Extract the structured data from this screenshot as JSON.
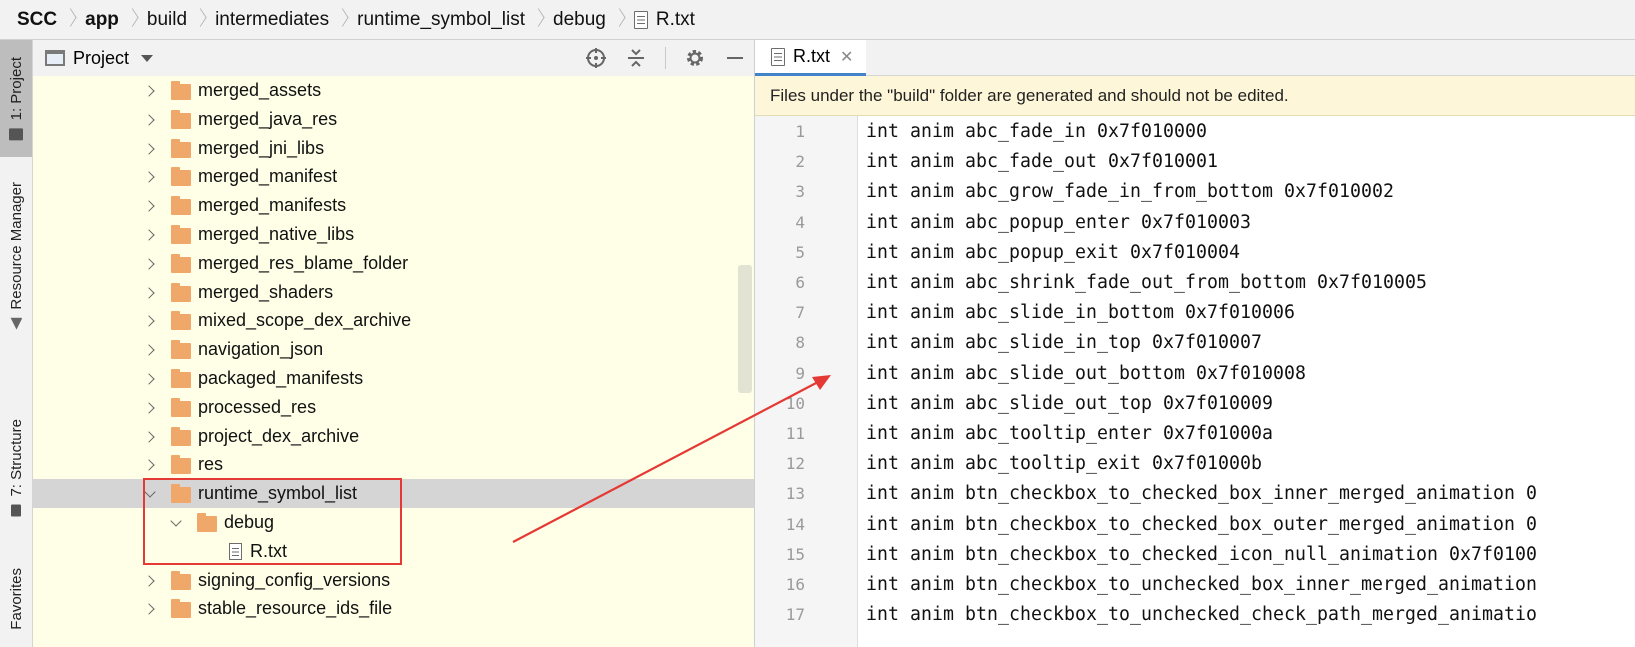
{
  "breadcrumb": {
    "items": [
      "SCC",
      "app",
      "build",
      "intermediates",
      "runtime_symbol_list",
      "debug",
      "R.txt"
    ]
  },
  "toolstrip": {
    "project_tab": "1: Project",
    "resource_manager_tab": "Resource Manager",
    "structure_tab": "7: Structure",
    "favorites_tab": "Favorites"
  },
  "project_panel": {
    "title": "Project",
    "tree": [
      {
        "label": "merged_assets",
        "type": "folder",
        "depth": 0,
        "expanded": false
      },
      {
        "label": "merged_java_res",
        "type": "folder",
        "depth": 0,
        "expanded": false
      },
      {
        "label": "merged_jni_libs",
        "type": "folder",
        "depth": 0,
        "expanded": false
      },
      {
        "label": "merged_manifest",
        "type": "folder",
        "depth": 0,
        "expanded": false
      },
      {
        "label": "merged_manifests",
        "type": "folder",
        "depth": 0,
        "expanded": false
      },
      {
        "label": "merged_native_libs",
        "type": "folder",
        "depth": 0,
        "expanded": false
      },
      {
        "label": "merged_res_blame_folder",
        "type": "folder",
        "depth": 0,
        "expanded": false
      },
      {
        "label": "merged_shaders",
        "type": "folder",
        "depth": 0,
        "expanded": false
      },
      {
        "label": "mixed_scope_dex_archive",
        "type": "folder",
        "depth": 0,
        "expanded": false
      },
      {
        "label": "navigation_json",
        "type": "folder",
        "depth": 0,
        "expanded": false
      },
      {
        "label": "packaged_manifests",
        "type": "folder",
        "depth": 0,
        "expanded": false
      },
      {
        "label": "processed_res",
        "type": "folder",
        "depth": 0,
        "expanded": false
      },
      {
        "label": "project_dex_archive",
        "type": "folder",
        "depth": 0,
        "expanded": false
      },
      {
        "label": "res",
        "type": "folder",
        "depth": 0,
        "expanded": false
      },
      {
        "label": "runtime_symbol_list",
        "type": "folder",
        "depth": 0,
        "expanded": true,
        "selected": true
      },
      {
        "label": "debug",
        "type": "folder",
        "depth": 1,
        "expanded": true
      },
      {
        "label": "R.txt",
        "type": "file",
        "depth": 2
      },
      {
        "label": "signing_config_versions",
        "type": "folder",
        "depth": 0,
        "expanded": false
      },
      {
        "label": "stable_resource_ids_file",
        "type": "folder",
        "depth": 0,
        "expanded": false
      }
    ]
  },
  "editor": {
    "tab_label": "R.txt",
    "banner": "Files under the \"build\" folder are generated and should not be edited.",
    "lines": [
      {
        "n": "1",
        "text": "int anim abc_fade_in 0x7f010000"
      },
      {
        "n": "2",
        "text": "int anim abc_fade_out 0x7f010001"
      },
      {
        "n": "3",
        "text": "int anim abc_grow_fade_in_from_bottom 0x7f010002"
      },
      {
        "n": "4",
        "text": "int anim abc_popup_enter 0x7f010003"
      },
      {
        "n": "5",
        "text": "int anim abc_popup_exit 0x7f010004"
      },
      {
        "n": "6",
        "text": "int anim abc_shrink_fade_out_from_bottom 0x7f010005"
      },
      {
        "n": "7",
        "text": "int anim abc_slide_in_bottom 0x7f010006"
      },
      {
        "n": "8",
        "text": "int anim abc_slide_in_top 0x7f010007"
      },
      {
        "n": "9",
        "text": "int anim abc_slide_out_bottom 0x7f010008"
      },
      {
        "n": "10",
        "text": "int anim abc_slide_out_top 0x7f010009"
      },
      {
        "n": "11",
        "text": "int anim abc_tooltip_enter 0x7f01000a"
      },
      {
        "n": "12",
        "text": "int anim abc_tooltip_exit 0x7f01000b"
      },
      {
        "n": "13",
        "text": "int anim btn_checkbox_to_checked_box_inner_merged_animation 0"
      },
      {
        "n": "14",
        "text": "int anim btn_checkbox_to_checked_box_outer_merged_animation 0"
      },
      {
        "n": "15",
        "text": "int anim btn_checkbox_to_checked_icon_null_animation 0x7f0100"
      },
      {
        "n": "16",
        "text": "int anim btn_checkbox_to_unchecked_box_inner_merged_animation"
      },
      {
        "n": "17",
        "text": "int anim btn_checkbox_to_unchecked_check_path_merged_animatio"
      }
    ],
    "current_line": "11"
  },
  "colors": {
    "tree_bg": "#ffffe8",
    "folder": "#f0a86a",
    "annotation": "#e53935",
    "tab_underline": "#4083c9"
  }
}
